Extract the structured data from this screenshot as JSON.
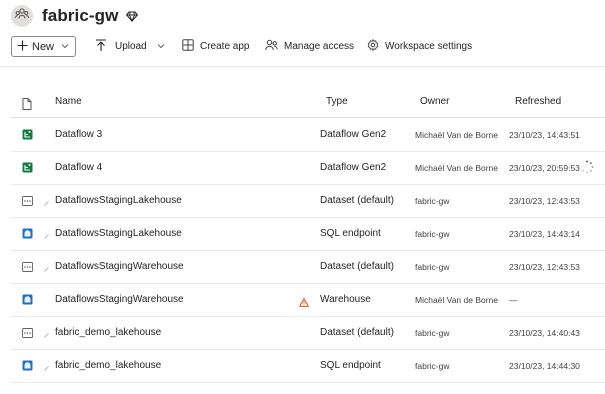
{
  "workspace": {
    "title": "fabric-gw",
    "avatar_icon": "people-group-icon",
    "premium_icon": "diamond-icon"
  },
  "toolbar": {
    "new_label": "New",
    "upload_label": "Upload",
    "create_app_label": "Create app",
    "manage_access_label": "Manage access",
    "workspace_settings_label": "Workspace settings"
  },
  "table": {
    "columns": {
      "name": "Name",
      "type": "Type",
      "owner": "Owner",
      "refreshed": "Refreshed"
    },
    "rows": [
      {
        "name": "Dataflow 3",
        "type": "Dataflow Gen2",
        "owner": "Michaël Van de Borne",
        "refreshed": "23/10/23, 14:43:51",
        "icon": "dataflow-icon"
      },
      {
        "name": "Dataflow 4",
        "type": "Dataflow Gen2",
        "owner": "Michaël Van de Borne",
        "refreshed": "23/10/23, 20:59:53",
        "icon": "dataflow-icon"
      },
      {
        "name": "DataflowsStagingLakehouse",
        "type": "Dataset (default)",
        "owner": "fabric-gw",
        "refreshed": "23/10/23, 12:43:53",
        "icon": "dataset-icon"
      },
      {
        "name": "DataflowsStagingLakehouse",
        "type": "SQL endpoint",
        "owner": "fabric-gw",
        "refreshed": "23/10/23, 14:43:14",
        "icon": "sql-endpoint-icon"
      },
      {
        "name": "DataflowsStagingWarehouse",
        "type": "Dataset (default)",
        "owner": "fabric-gw",
        "refreshed": "23/10/23, 12:43:53",
        "icon": "dataset-icon"
      },
      {
        "name": "DataflowsStagingWarehouse",
        "type": "Warehouse",
        "owner": "Michaël Van de Borne",
        "refreshed": "—",
        "icon": "warehouse-icon"
      },
      {
        "name": "fabric_demo_lakehouse",
        "type": "Dataset (default)",
        "owner": "fabric-gw",
        "refreshed": "23/10/23, 14:40:43",
        "icon": "dataset-icon"
      },
      {
        "name": "fabric_demo_lakehouse",
        "type": "SQL endpoint",
        "owner": "fabric-gw",
        "refreshed": "23/10/23, 14:44:30",
        "icon": "sql-endpoint-icon"
      }
    ]
  },
  "colors": {
    "dataflow_green": "#107c41",
    "endpoint_blue": "#1e6fc8",
    "warning_orange": "#d83b01"
  }
}
